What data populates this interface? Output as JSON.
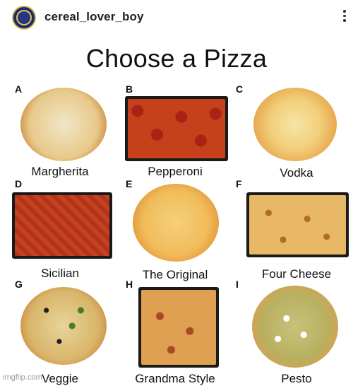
{
  "post": {
    "username": "cereal_lover_boy",
    "watermark": "imgflip.com"
  },
  "title": "Choose a Pizza",
  "pizzas": [
    {
      "letter": "A",
      "name": "Margherita"
    },
    {
      "letter": "B",
      "name": "Pepperoni"
    },
    {
      "letter": "C",
      "name": "Vodka"
    },
    {
      "letter": "D",
      "name": "Sicilian"
    },
    {
      "letter": "E",
      "name": "The Original"
    },
    {
      "letter": "F",
      "name": "Four Cheese"
    },
    {
      "letter": "G",
      "name": "Veggie"
    },
    {
      "letter": "H",
      "name": "Grandma Style"
    },
    {
      "letter": "I",
      "name": "Pesto"
    }
  ],
  "icons": {
    "avatar": "avatar-badge-icon",
    "more": "more-options-icon"
  },
  "colors": {
    "crust": "#d9a35a",
    "sauce": "#b8321a",
    "cheese": "#f2c46b",
    "pan": "#1a1a1a"
  }
}
